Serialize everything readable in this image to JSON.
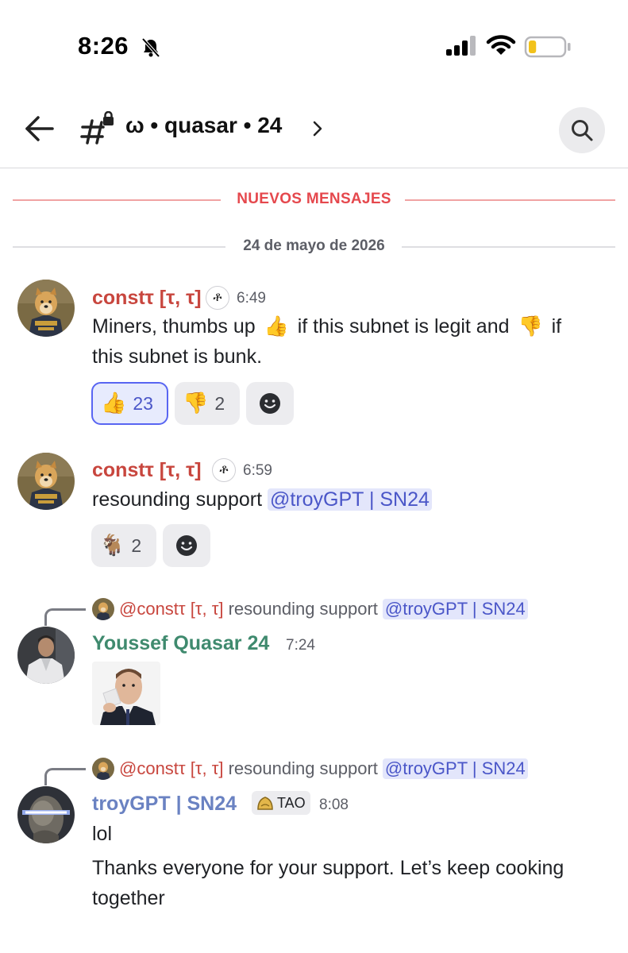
{
  "status_bar": {
    "time": "8:26",
    "icons": [
      "bell-off-icon",
      "signal-icon",
      "wifi-icon",
      "battery-icon"
    ],
    "battery_level": 0.22
  },
  "header": {
    "channel_name": "ω • quasar • 24",
    "icons": [
      "back-arrow-icon",
      "private-channel-icon",
      "chevron-right-icon",
      "search-icon"
    ]
  },
  "dividers": {
    "new_messages": "NUEVOS MENSAJES",
    "date": "24 de mayo de 2026"
  },
  "colors": {
    "const_username": "#c8463e",
    "youssef_username": "#3f8a6e",
    "troy_username": "#6a82c2",
    "mention_bg": "#e3e6fb",
    "mention_text": "#4a56c8",
    "new_divider": "#e5484d"
  },
  "messages": [
    {
      "username": "constτ [τ, τ]",
      "badge": "ቶ",
      "time": "6:49",
      "text_a": "Miners, thumbs up",
      "emoji_a": "👍",
      "text_b": " if this subnet is legit and",
      "emoji_b": "👎",
      "text_c": " if",
      "text_d": "this subnet is bunk.",
      "reactions": [
        {
          "emoji": "👍",
          "count": "23",
          "active": true
        },
        {
          "emoji": "👎",
          "count": "2",
          "active": false
        }
      ]
    },
    {
      "username": "constτ [τ, τ]",
      "badge": "ቶ",
      "time": "6:59",
      "text": "resounding support",
      "mention": "@troyGPT | SN24",
      "reactions": [
        {
          "emoji": "🐐",
          "count": "2",
          "active": false
        }
      ]
    },
    {
      "reply_to": {
        "user": "@constτ [τ, τ]",
        "text": "resounding support",
        "mention": "@troyGPT | SN24"
      },
      "username": "Youssef Quasar 24",
      "time": "7:24"
    },
    {
      "reply_to": {
        "user": "@constτ [τ, τ]",
        "text": "resounding support",
        "mention": "@troyGPT | SN24"
      },
      "username": "troyGPT | SN24",
      "tag": "TAO",
      "time": "8:08",
      "line1": "lol",
      "line2": "Thanks everyone for your support. Let’s keep cooking",
      "line3": "together"
    }
  ]
}
